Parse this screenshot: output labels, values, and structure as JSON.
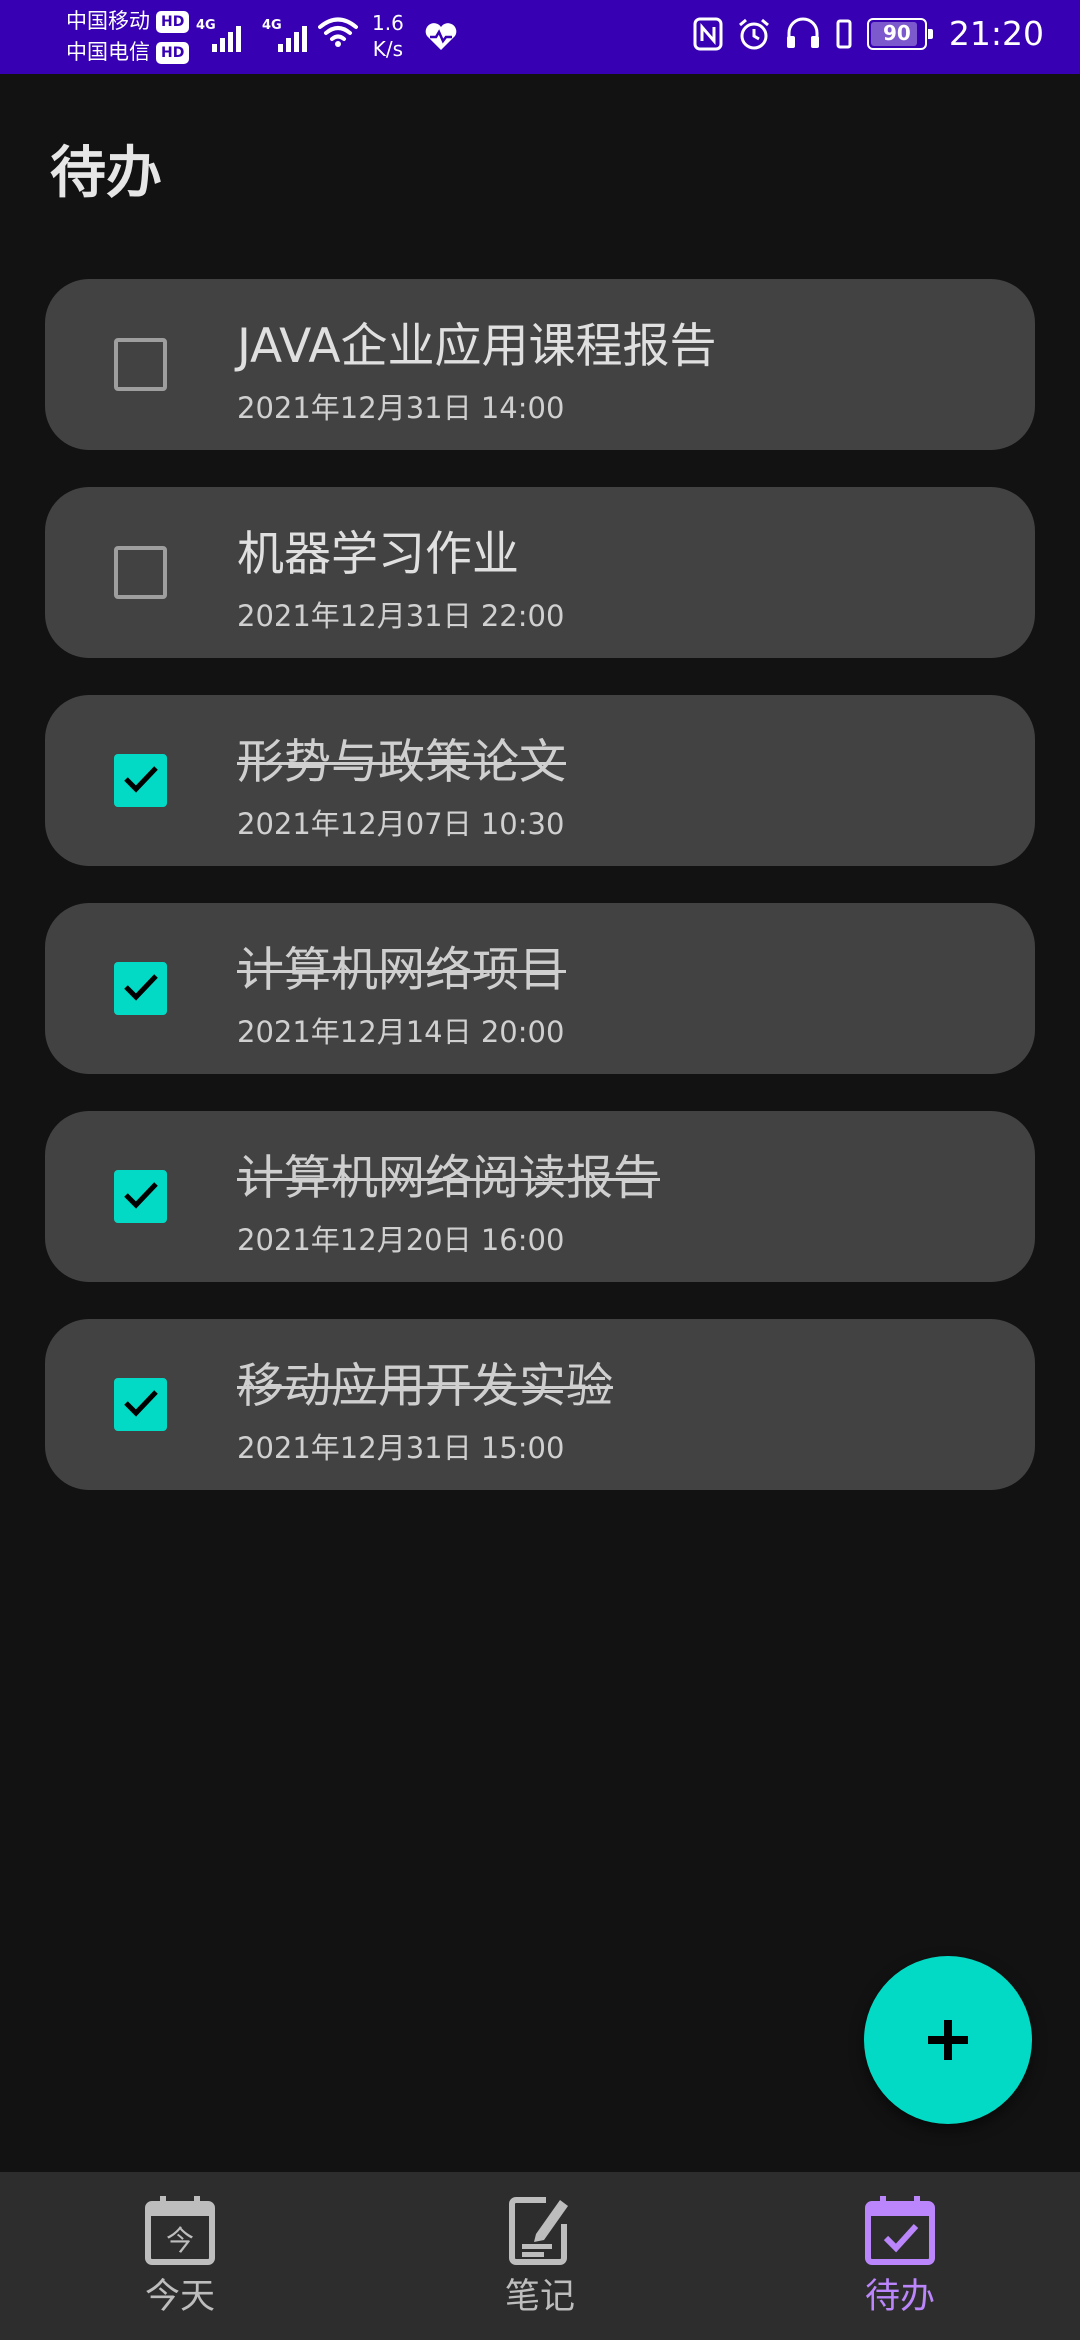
{
  "status_bar": {
    "carrier_1": "中国移动",
    "carrier_2": "中国电信",
    "hd_badge": "HD",
    "network_1": "4G",
    "network_2": "4G",
    "speed_value": "1.6",
    "speed_unit": "K/s",
    "battery_level": "90",
    "battery_fraction": 0.9,
    "time": "21:20"
  },
  "header": {
    "title": "待办"
  },
  "todos": [
    {
      "title": "JAVA企业应用课程报告",
      "time": "2021年12月31日 14:00",
      "done": false
    },
    {
      "title": "机器学习作业",
      "time": "2021年12月31日 22:00",
      "done": false
    },
    {
      "title": "形势与政策论文",
      "time": "2021年12月07日 10:30",
      "done": true
    },
    {
      "title": "计算机网络项目",
      "time": "2021年12月14日 20:00",
      "done": true
    },
    {
      "title": "计算机网络阅读报告",
      "time": "2021年12月20日 16:00",
      "done": true
    },
    {
      "title": "移动应用开发实验",
      "time": "2021年12月31日 15:00",
      "done": true
    }
  ],
  "fab": {
    "icon": "plus-icon"
  },
  "bottom_nav": {
    "items": [
      {
        "label": "今天",
        "icon": "calendar-today-icon",
        "active": false
      },
      {
        "label": "笔记",
        "icon": "note-edit-icon",
        "active": false
      },
      {
        "label": "待办",
        "icon": "calendar-check-icon",
        "active": true
      }
    ]
  },
  "colors": {
    "status_bar": "#3700B3",
    "background": "#121212",
    "card": "#424242",
    "accent": "#03DAC5",
    "active_nav": "#BB86FC",
    "inactive_nav": "#BDBDBD"
  }
}
